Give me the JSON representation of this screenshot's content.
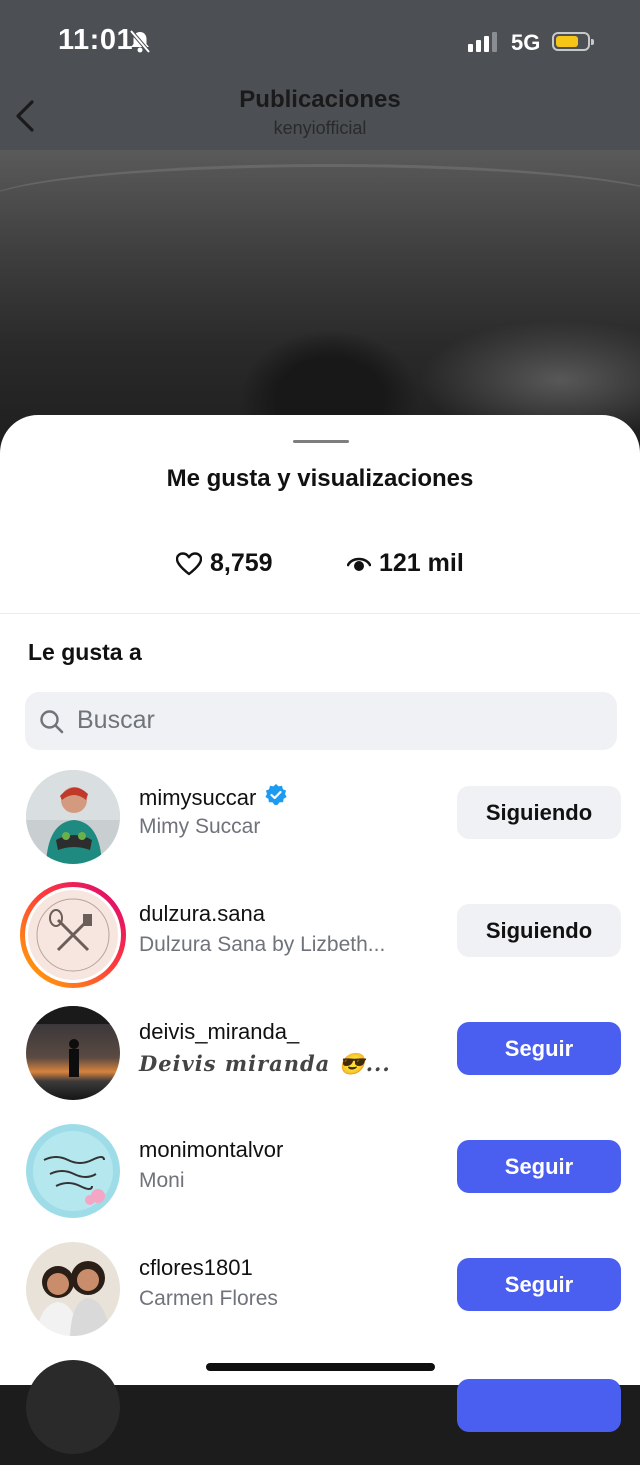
{
  "status_bar": {
    "time": "11:01",
    "network": "5G",
    "battery_color": "#f5c518"
  },
  "header": {
    "title": "Publicaciones",
    "subtitle": "kenyiofficial"
  },
  "sheet": {
    "title": "Me gusta y visualizaciones",
    "likes_count": "8,759",
    "views_count": "121 mil",
    "section_label": "Le gusta a",
    "search_placeholder": "Buscar"
  },
  "users": [
    {
      "username": "mimysuccar",
      "name": "Mimy Succar",
      "verified": true,
      "button": "Siguiendo",
      "state": "following"
    },
    {
      "username": "dulzura.sana",
      "name": "Dulzura Sana by Lizbeth...",
      "verified": false,
      "button": "Siguiendo",
      "state": "following",
      "has_story": true
    },
    {
      "username": "deivis_miranda_",
      "name": "𝑫𝒆𝒊𝒗𝒊𝒔 𝒎𝒊𝒓𝒂𝒏𝒅𝒂 😎...",
      "verified": false,
      "button": "Seguir",
      "state": "follow"
    },
    {
      "username": "monimontalvor",
      "name": "Moni",
      "verified": false,
      "button": "Seguir",
      "state": "follow"
    },
    {
      "username": "cflores1801",
      "name": "Carmen Flores",
      "verified": false,
      "button": "Seguir",
      "state": "follow"
    }
  ],
  "colors": {
    "accent": "#4a5ef0",
    "verified": "#1d9bf0",
    "story_ring_start": "#ffb000",
    "story_ring_end": "#d3007c"
  }
}
